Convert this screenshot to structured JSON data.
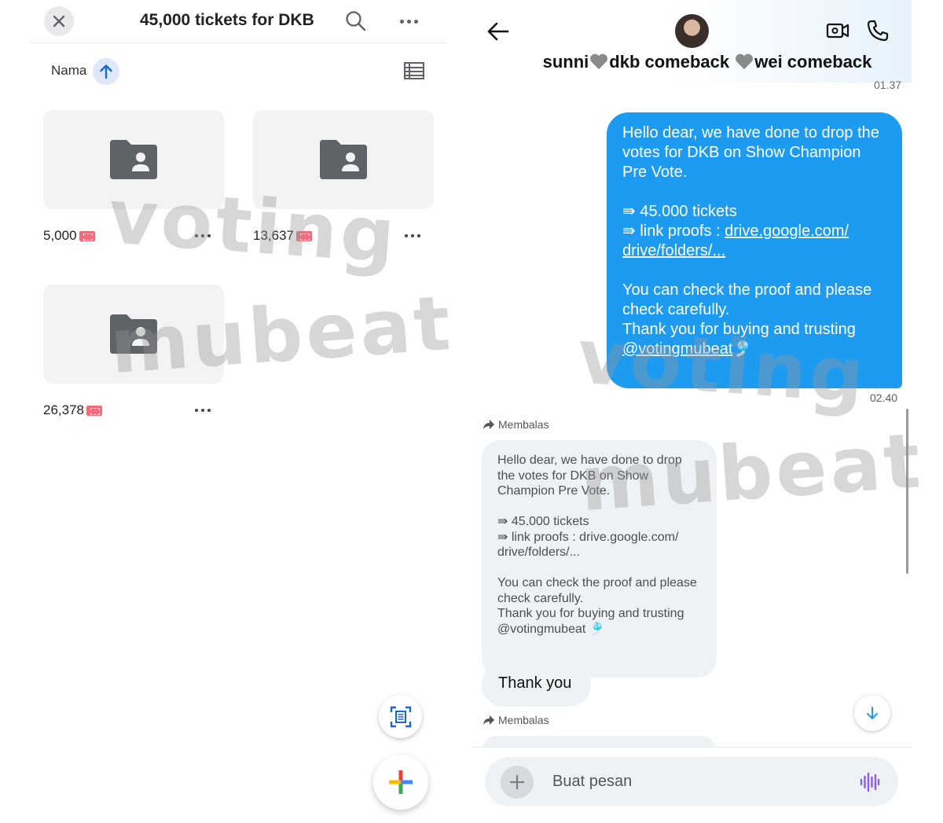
{
  "drive": {
    "title": "45,000 tickets for DKB",
    "sort_label": "Nama",
    "folders": [
      {
        "name": "5,000"
      },
      {
        "name": "13,637"
      },
      {
        "name": "26,378"
      }
    ],
    "icons": {
      "close": "close-icon",
      "search": "search-icon",
      "more": "more-horiz-icon",
      "sort": "arrow-up-icon",
      "view": "list-view-icon",
      "folder": "shared-folder-icon",
      "ticket": "ticket-emoji",
      "scan": "document-scan-icon",
      "new": "plus-icon"
    },
    "colors": {
      "folder": "#5f6368",
      "sort_bg": "#dde8f8",
      "ticket": "#f26b7a"
    }
  },
  "chat": {
    "name_part1": "sunni",
    "name_part2": "dkb comeback ",
    "name_part3": "wei comeback",
    "prev_time": "01.37",
    "sent": {
      "line1": "Hello dear, we have done to drop the votes for DKB on Show Champion Pre Vote.",
      "line2": "⇛ 45.000 tickets",
      "line3_prefix": "⇛ link proofs : ",
      "line3_link": "drive.google.com/ drive/folders/...",
      "line4": "You can check the proof and please check carefully.",
      "line5": "Thank you for buying and trusting",
      "mention": "@votingmubeat",
      "emoji": "🎐",
      "time": "02.40"
    },
    "reply_label": "Membalas",
    "quoted": {
      "line1": "Hello dear, we have done to drop the votes for DKB on Show Champion Pre Vote.",
      "line2": "⇛ 45.000 tickets",
      "line3": "⇛ link proofs : drive.google.com/ drive/folders/...",
      "line4": "You can check the proof and please check carefully.",
      "line5": "Thank you for buying and trusting @votingmubeat 🎐"
    },
    "reply_text": "Thank you",
    "composer_placeholder": "Buat pesan",
    "colors": {
      "sent_bubble": "#1d9bf0",
      "received_bubble": "#eff2f5",
      "accent": "#1d9bf0"
    }
  },
  "watermark": {
    "line1": "voting",
    "line2": "mubeat"
  }
}
